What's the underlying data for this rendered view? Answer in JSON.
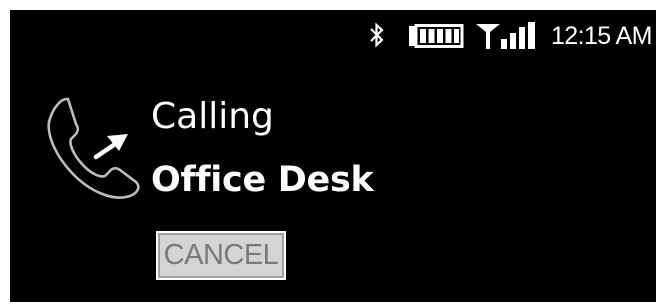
{
  "status_bar": {
    "time": "12:15 AM",
    "icons": [
      "bluetooth-icon",
      "battery-icon",
      "signal-strength-icon"
    ]
  },
  "call": {
    "icon": "outgoing-call-icon",
    "status_label": "Calling",
    "contact_name": "Office Desk"
  },
  "actions": {
    "cancel_label": "CANCEL"
  },
  "colors": {
    "background": "#000000",
    "text": "#ffffff",
    "button_background": "#d4d4d4",
    "button_text": "#7a7a7a"
  }
}
